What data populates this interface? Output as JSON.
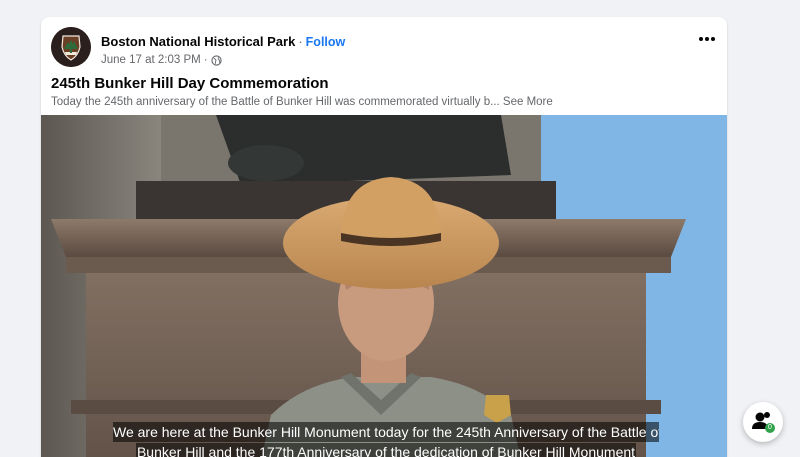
{
  "post": {
    "page_name": "Boston National Historical Park",
    "separator": "·",
    "follow_label": "Follow",
    "timestamp": "June 17 at 2:03 PM",
    "meta_separator": "·",
    "privacy_icon": "globe-icon",
    "more_icon": "more-options-icon",
    "title": "245th Bunker Hill Day Commemoration",
    "description": "Today the 245th anniversary of the Battle of Bunker Hill was commemorated virtually b...",
    "see_more_label": "See More"
  },
  "video": {
    "caption_line1": "We are here at the Bunker Hill Monument today for the 245th Anniversary of the Battle of",
    "caption_line2": "Bunker Hill and the 177th Anniversary of the dedication of Bunker Hill Monument"
  },
  "floating": {
    "icon": "people-icon",
    "badge_count": "0"
  },
  "colors": {
    "accent": "#1877f2",
    "background": "#f0f2f5",
    "sky": "#7fb4e4",
    "badge": "#31a24c"
  }
}
